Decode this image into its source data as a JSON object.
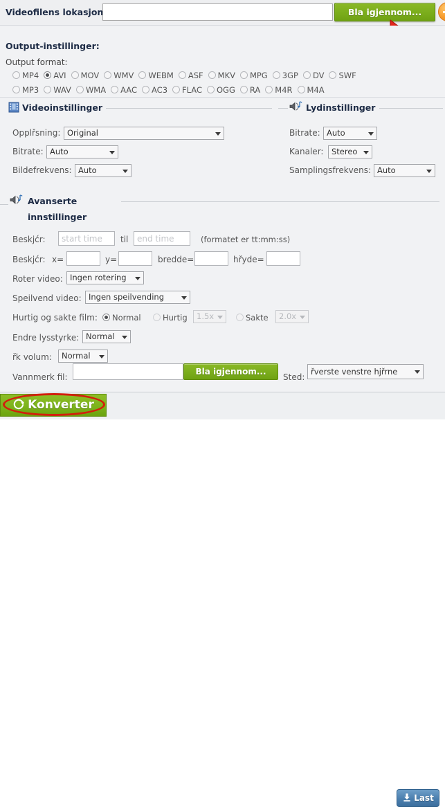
{
  "file_row": {
    "label": "Videofilens lokasjon:",
    "input_value": "",
    "input_placeholder": "",
    "browse_label": "Bla igjennom...",
    "add_icon": "plus-icon"
  },
  "output": {
    "title": "Output-instillinger:",
    "format_label": "Output format:",
    "formats_row1": [
      {
        "label": "MP4",
        "checked": false
      },
      {
        "label": "AVI",
        "checked": true
      },
      {
        "label": "MOV",
        "checked": false
      },
      {
        "label": "WMV",
        "checked": false
      },
      {
        "label": "WEBM",
        "checked": false
      },
      {
        "label": "ASF",
        "checked": false
      },
      {
        "label": "MKV",
        "checked": false
      },
      {
        "label": "MPG",
        "checked": false
      },
      {
        "label": "3GP",
        "checked": false
      },
      {
        "label": "DV",
        "checked": false
      },
      {
        "label": "SWF",
        "checked": false
      }
    ],
    "formats_row2": [
      {
        "label": "MP3",
        "checked": false
      },
      {
        "label": "WAV",
        "checked": false
      },
      {
        "label": "WMA",
        "checked": false
      },
      {
        "label": "AAC",
        "checked": false
      },
      {
        "label": "AC3",
        "checked": false
      },
      {
        "label": "FLAC",
        "checked": false
      },
      {
        "label": "OGG",
        "checked": false
      },
      {
        "label": "RA",
        "checked": false
      },
      {
        "label": "M4R",
        "checked": false
      },
      {
        "label": "M4A",
        "checked": false
      }
    ]
  },
  "video": {
    "heading": "Videoinstillinger",
    "resolution_label": "Opplřsning:",
    "resolution_value": "Original",
    "bitrate_label": "Bitrate:",
    "bitrate_value": "Auto",
    "framerate_label": "Bildefrekvens:",
    "framerate_value": "Auto"
  },
  "audio": {
    "heading": "Lydinstillinger",
    "bitrate_label": "Bitrate:",
    "bitrate_value": "Auto",
    "channels_label": "Kanaler:",
    "channels_value": "Stereo",
    "samplerate_label": "Samplingsfrekvens:",
    "samplerate_value": "Auto"
  },
  "advanced": {
    "heading_line1": "Avanserte",
    "heading_line2": "innstillinger",
    "trim_label": "Beskjćr:",
    "trim_start_placeholder": "start time",
    "trim_start_value": "",
    "trim_to_label": "til",
    "trim_end_placeholder": "end time",
    "trim_end_value": "",
    "trim_format_hint": "(formatet er tt:mm:ss)",
    "crop_label": "Beskjćr:",
    "crop_x_label": "x=",
    "crop_x_value": "",
    "crop_y_label": "y=",
    "crop_y_value": "",
    "crop_w_label": "bredde=",
    "crop_w_value": "",
    "crop_h_label": "hřyde=",
    "crop_h_value": "",
    "rotate_label": "Roter video:",
    "rotate_value": "Ingen rotering",
    "flip_label": "Speilvend video:",
    "flip_value": "Ingen speilvending",
    "speed_label": "Hurtig og sakte film:",
    "speed_normal_label": "Normal",
    "speed_normal_checked": true,
    "speed_fast_label": "Hurtig",
    "speed_fast_checked": false,
    "speed_fast_value": "1.5x",
    "speed_slow_label": "Sakte",
    "speed_slow_checked": false,
    "speed_slow_value": "2.0x",
    "brightness_label": "Endre lysstyrke:",
    "brightness_value": "Normal",
    "volume_label": "řk volum:",
    "volume_value": "Normal",
    "watermark_label": "Vannmerk fil:",
    "watermark_input_value": "",
    "watermark_browse_label": "Bla igjennom...",
    "watermark_place_label": "Sted:",
    "watermark_place_value": "řverste venstre hjřrne"
  },
  "bottom": {
    "convert_label": "Konverter",
    "convert_icon": "refresh-icon",
    "download_label": "Last",
    "download_icon": "download-icon"
  },
  "colors": {
    "green": "#7cae1d",
    "orange": "#f79b2b",
    "blue": "#4b7fae",
    "annotation_red": "#d21f0c",
    "heading_navy": "#1d2b45"
  }
}
